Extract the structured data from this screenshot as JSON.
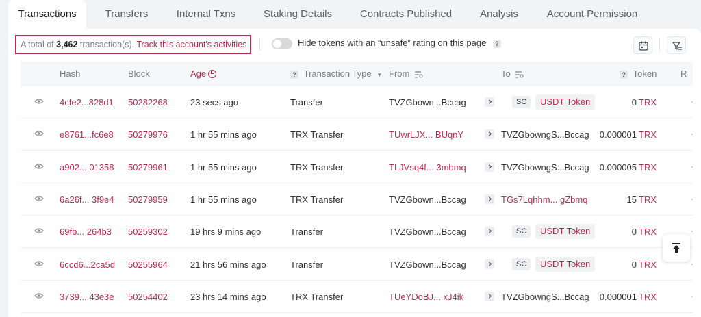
{
  "tabs": [
    {
      "label": "Transactions",
      "active": true
    },
    {
      "label": "Transfers"
    },
    {
      "label": "Internal Txns"
    },
    {
      "label": "Staking Details"
    },
    {
      "label": "Contracts Published"
    },
    {
      "label": "Analysis"
    },
    {
      "label": "Account Permission"
    }
  ],
  "summary": {
    "prefix": "A total of",
    "count": "3,462",
    "suffix": "transaction(s).",
    "link": "Track this account's activities"
  },
  "filter": {
    "toggle_label": "Hide tokens with an “unsafe” rating on this page",
    "toggle_on": false
  },
  "columns": {
    "hash": "Hash",
    "block": "Block",
    "age": "Age",
    "type": "Transaction Type",
    "from": "From",
    "to": "To",
    "token": "Token",
    "result": "R"
  },
  "rows": [
    {
      "hash": "4cfe2...828d1",
      "block": "50282268",
      "age": "23 secs ago",
      "type": "Transfer",
      "from": "TVZGbown...Bccag",
      "from_link": false,
      "to_sc": true,
      "to": "USDT Token",
      "to_link": true,
      "amount": "0",
      "unit": "TRX"
    },
    {
      "hash": "e8761...fc6e8",
      "block": "50279976",
      "age": "1 hr 55 mins ago",
      "type": "TRX Transfer",
      "from": "TUwrLJX... BUqnY",
      "from_link": true,
      "to_sc": false,
      "to": "TVZGbowngS...Bccag",
      "to_link": false,
      "amount": "0.000001",
      "unit": "TRX"
    },
    {
      "hash": "a902... 01358",
      "block": "50279961",
      "age": "1 hr 55 mins ago",
      "type": "TRX Transfer",
      "from": "TLJVsq4f... 3mbmq",
      "from_link": true,
      "to_sc": false,
      "to": "TVZGbowngS...Bccag",
      "to_link": false,
      "amount": "0.000005",
      "unit": "TRX"
    },
    {
      "hash": "6a26f... 3f9e4",
      "block": "50279959",
      "age": "1 hr 55 mins ago",
      "type": "TRX Transfer",
      "from": "TVZGbown...Bccag",
      "from_link": false,
      "to_sc": false,
      "to": "TGs7Lqhhm... gZbmq",
      "to_link": true,
      "amount": "15",
      "unit": "TRX"
    },
    {
      "hash": "69fb... 264b3",
      "block": "50259302",
      "age": "19 hrs 9 mins ago",
      "type": "Transfer",
      "from": "TVZGbown...Bccag",
      "from_link": false,
      "to_sc": true,
      "to": "USDT Token",
      "to_link": true,
      "amount": "0",
      "unit": "TRX"
    },
    {
      "hash": "6ccd6...2ca5d",
      "block": "50255964",
      "age": "21 hrs 56 mins ago",
      "type": "Transfer",
      "from": "TVZGbown...Bccag",
      "from_link": false,
      "to_sc": true,
      "to": "USDT Token",
      "to_link": true,
      "amount": "0",
      "unit": "TRX"
    },
    {
      "hash": "3739... 43e3e",
      "block": "50254402",
      "age": "23 hrs 14 mins ago",
      "type": "TRX Transfer",
      "from": "TUeYDoBJ... xJ4ik",
      "from_link": true,
      "to_sc": false,
      "to": "TVZGbowngS...Bccag",
      "to_link": false,
      "amount": "0.000001",
      "unit": "TRX"
    }
  ],
  "sc_label": "SC",
  "icons": {
    "view": "eye-icon",
    "calendar": "calendar-icon",
    "filter": "filter-icon",
    "scroll_top": "arrow-up-to-top-icon"
  },
  "colors": {
    "accent": "#b0304f",
    "header_bg": "#f6f7f9"
  }
}
